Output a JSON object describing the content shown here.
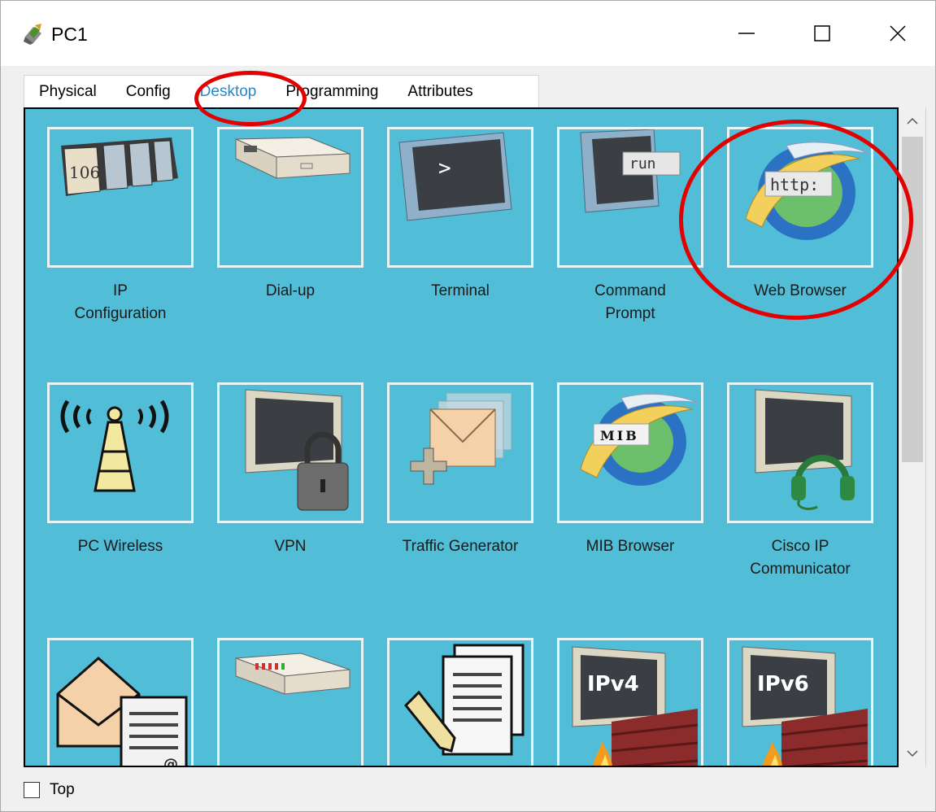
{
  "window": {
    "title": "PC1",
    "title_icon": "pc-device-icon"
  },
  "tabs": [
    {
      "label": "Physical",
      "active": false
    },
    {
      "label": "Config",
      "active": false
    },
    {
      "label": "Desktop",
      "active": true
    },
    {
      "label": "Programming",
      "active": false
    },
    {
      "label": "Attributes",
      "active": false
    }
  ],
  "tiles": [
    {
      "line1": "IP",
      "line2": "Configuration",
      "icon": "ip-configuration-icon",
      "icon_text": "106"
    },
    {
      "line1": "Dial-up",
      "line2": "",
      "icon": "dial-up-modem-icon"
    },
    {
      "line1": "Terminal",
      "line2": "",
      "icon": "terminal-icon",
      "icon_text": ">"
    },
    {
      "line1": "Command",
      "line2": "Prompt",
      "icon": "command-prompt-icon",
      "icon_text": "run"
    },
    {
      "line1": "Web Browser",
      "line2": "",
      "icon": "web-browser-icon",
      "icon_text": "http:"
    },
    {
      "line1": "PC Wireless",
      "line2": "",
      "icon": "wireless-tower-icon"
    },
    {
      "line1": "VPN",
      "line2": "",
      "icon": "vpn-lock-icon"
    },
    {
      "line1": "Traffic Generator",
      "line2": "",
      "icon": "traffic-generator-icon"
    },
    {
      "line1": "MIB Browser",
      "line2": "",
      "icon": "mib-browser-icon",
      "icon_text": "MIB"
    },
    {
      "line1": "Cisco IP",
      "line2": "Communicator",
      "icon": "ip-communicator-headset-icon"
    },
    {
      "line1": "",
      "line2": "",
      "icon": "email-icon",
      "icon_text": "@"
    },
    {
      "line1": "",
      "line2": "",
      "icon": "pppoe-dialer-icon"
    },
    {
      "line1": "",
      "line2": "",
      "icon": "text-editor-icon"
    },
    {
      "line1": "",
      "line2": "",
      "icon": "ipv4-firewall-icon",
      "icon_text": "IPv4"
    },
    {
      "line1": "",
      "line2": "",
      "icon": "ipv6-firewall-icon",
      "icon_text": "IPv6"
    }
  ],
  "footer": {
    "checkbox_label": "Top",
    "checked": false
  },
  "colors": {
    "desktop_bg": "#52bdd6",
    "active_tab": "#2a86c8",
    "annotation": "#e30000"
  }
}
